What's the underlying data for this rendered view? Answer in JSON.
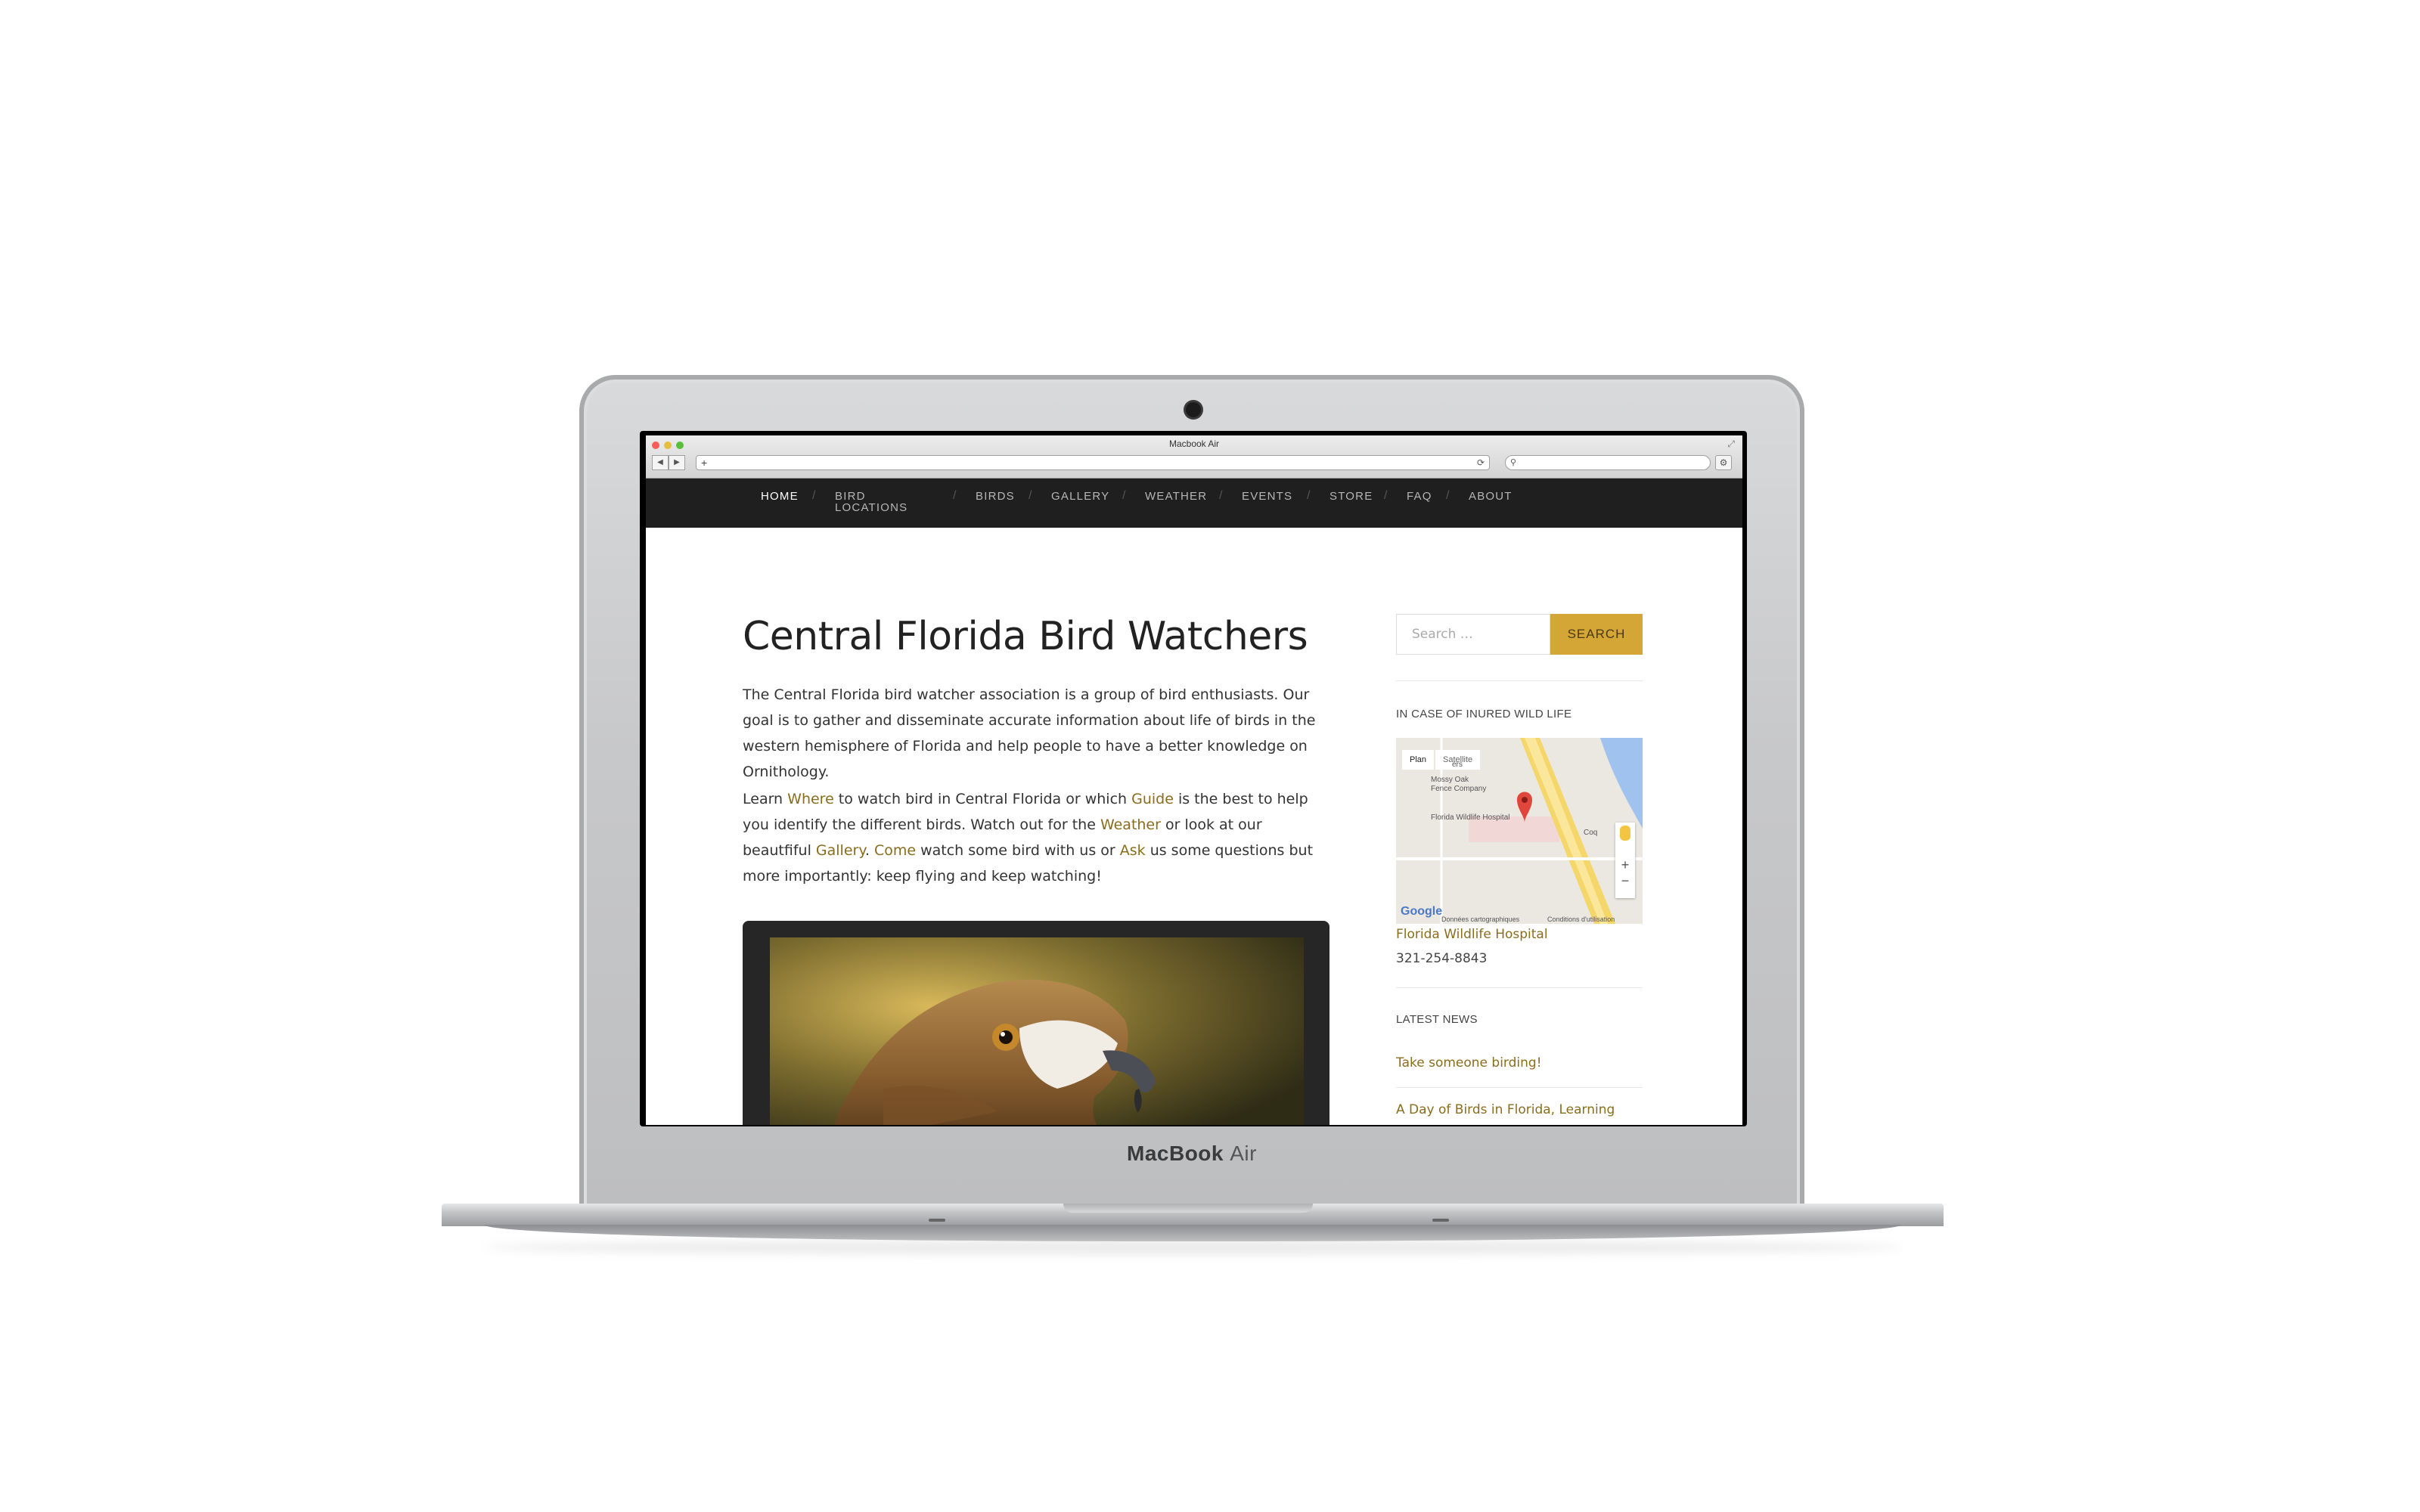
{
  "device": {
    "brand_bold": "MacBook",
    "brand_light": "Air"
  },
  "browser": {
    "window_title": "Macbook Air",
    "back_label": "◀",
    "forward_label": "▶",
    "new_tab_label": "+",
    "reload_label": "⟳",
    "search_icon": "⚲",
    "settings_icon": "⚙",
    "resize_icon": "⤢"
  },
  "nav": {
    "items": [
      {
        "label": "HOME"
      },
      {
        "label": "BIRD\nLOCATIONS"
      },
      {
        "label": "BIRDS"
      },
      {
        "label": "GALLERY"
      },
      {
        "label": "WEATHER"
      },
      {
        "label": "EVENTS"
      },
      {
        "label": "STORE"
      },
      {
        "label": "FAQ"
      },
      {
        "label": "ABOUT"
      }
    ],
    "separator": "/"
  },
  "main": {
    "title": "Central Florida Bird Watchers",
    "intro": "The Central Florida bird watcher association is a group of bird enthusiasts. Our goal is to gather and disseminate accurate information about life of birds in the western hemisphere of Florida and help people to have a better knowledge on Ornithology.",
    "p2": {
      "t1": "Learn ",
      "l_where": "Where",
      "t2": " to watch bird in Central Florida or which ",
      "l_guide": "Guide",
      "t3": " is the best to help you identify the different birds. Watch out for the ",
      "l_weather": "Weather",
      "t4": " or look at our beautfiful ",
      "l_gallery": "Gallery",
      "t5": ". ",
      "l_come": "Come",
      "t6": " watch some bird with us or ",
      "l_ask": "Ask",
      "t7": " us some questions but more importantly: keep flying and keep watching!"
    }
  },
  "sidebar": {
    "search_placeholder": "Search …",
    "search_button": "SEARCH",
    "injured_title": "IN CASE OF INURED WILD LIFE",
    "map": {
      "tab_plan": "Plan",
      "tab_satellite": "Satellite",
      "label_mossy": "Mossy Oak\nFence Company",
      "label_hospital": "Florida Wildlife Hospital",
      "label_road": "Coq",
      "label_ers": "ers",
      "logo": "Google",
      "credit_data": "Données cartographiques",
      "credit_terms": "Conditions d'utilisation",
      "zoom_in": "+",
      "zoom_out": "−"
    },
    "hospital_link": "Florida Wildlife Hospital",
    "hospital_phone": "321-254-8843",
    "news_title": "LATEST NEWS",
    "news": [
      {
        "title": "Take someone birding!"
      },
      {
        "title": "A Day of Birds in Florida, Learning"
      }
    ]
  },
  "colors": {
    "accent": "#d4a635",
    "link": "#8a6d1c",
    "nav_bg": "#1f1f1f"
  }
}
